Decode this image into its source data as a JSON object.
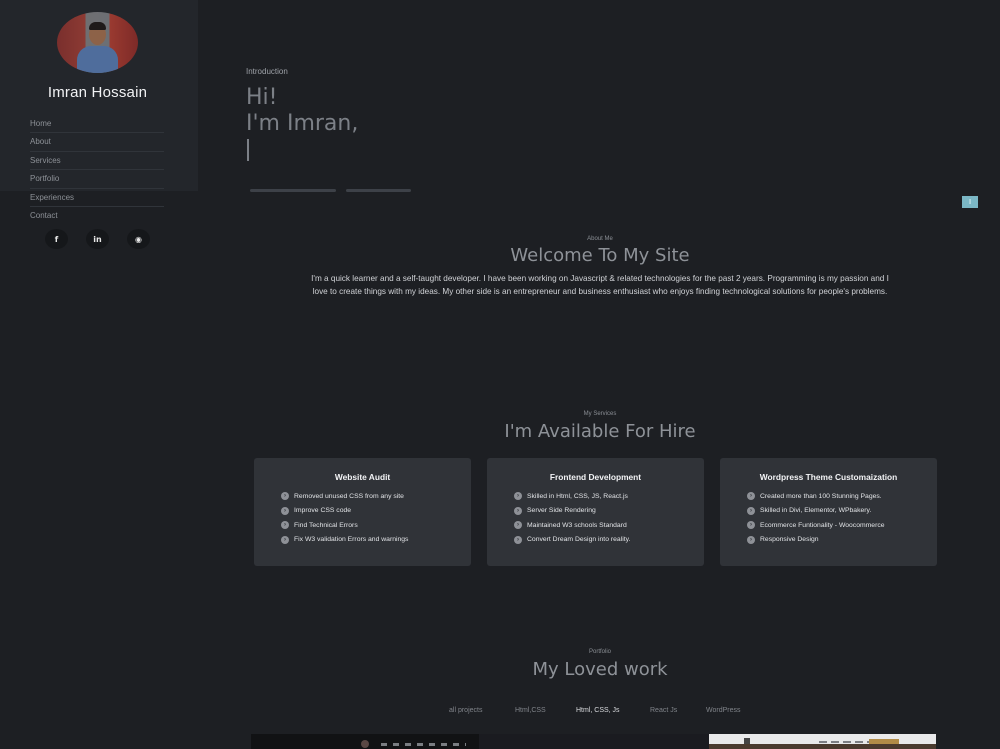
{
  "sidebar": {
    "name": "Imran Hossain",
    "nav": [
      "Home",
      "About",
      "Services",
      "Portfolio",
      "Experiences",
      "Contact"
    ],
    "social_icons": [
      {
        "name": "facebook-icon",
        "glyph": "f"
      },
      {
        "name": "linkedin-icon",
        "glyph": "in"
      },
      {
        "name": "github-icon",
        "glyph": "◉"
      }
    ]
  },
  "hero": {
    "eyebrow": "Introduction",
    "line1": "Hi!",
    "line2": "I'm Imran,",
    "line3": "|"
  },
  "scroll_top": {
    "label": "I"
  },
  "about": {
    "eyebrow": "About Me",
    "title": "Welcome To My Site",
    "text": "I'm a quick learner and a self-taught developer. I have been working on Javascript & related technologies for the past 2 years. Programming is my passion and I love to create things with my ideas. My other side is an entrepreneur and business enthusiast who enjoys finding technological solutions for people's problems."
  },
  "services": {
    "eyebrow": "My Services",
    "title": "I'm Available For Hire",
    "cards": [
      {
        "title": "Website Audit",
        "items": [
          "Removed unused CSS from any site",
          "Improve CSS code",
          "Find Technical Errors",
          "Fix W3 validation Errors and warnings"
        ]
      },
      {
        "title": "Frontend Development",
        "items": [
          "Skilled in Html, CSS, JS, React.js",
          "Server Side Rendering",
          "Maintained W3 schools Standard",
          "Convert Dream Design into reality."
        ]
      },
      {
        "title": "Wordpress Theme Customaization",
        "items": [
          "Created more than 100 Stunning Pages.",
          "Skilled in Divi, Elementor, WPbakery.",
          "Ecommerce Funtionality - Woocommerce",
          "Responsive Design"
        ]
      }
    ]
  },
  "portfolio": {
    "eyebrow": "Portfolio",
    "title": "My Loved work",
    "filters": [
      "all projects",
      "Html,CSS",
      "Html, CSS, Js",
      "React Js",
      "WordPress"
    ],
    "active_filter": "Html, CSS, Js"
  },
  "colors": {
    "background": "#1d1f23",
    "sidebar": "#23262b",
    "card": "#303338",
    "accent": "#7bb7c5"
  }
}
